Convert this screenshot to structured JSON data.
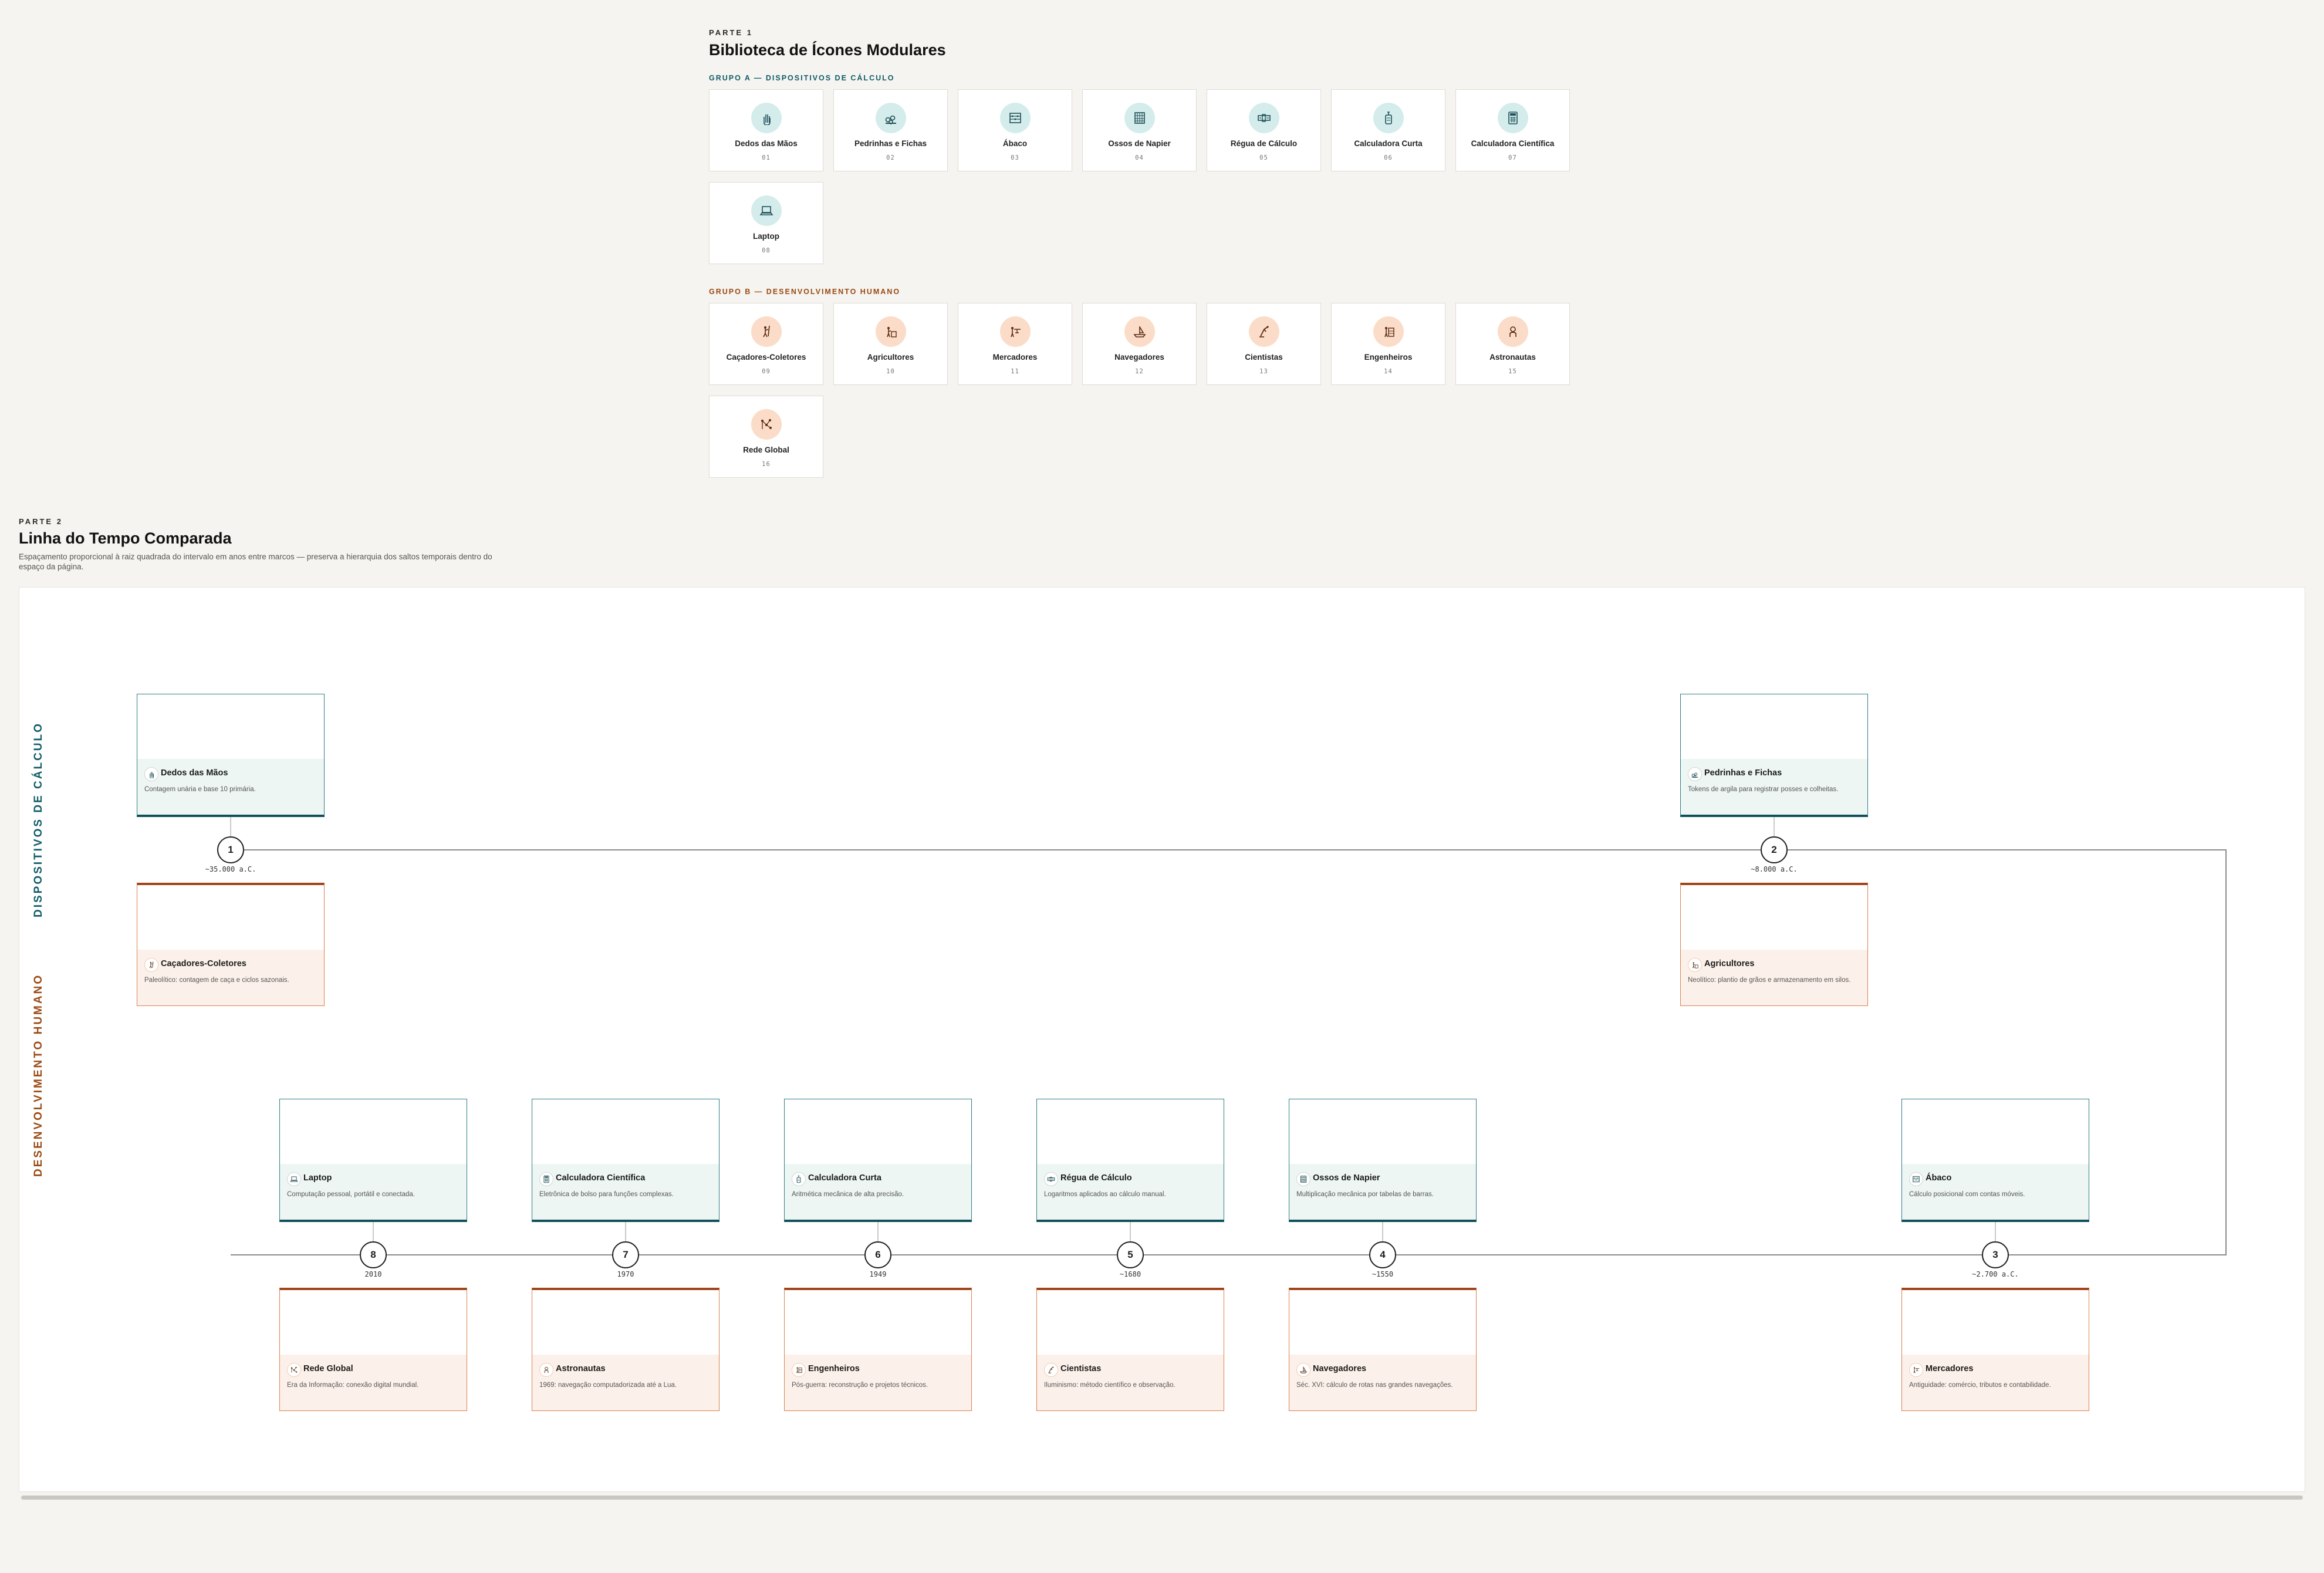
{
  "part1": {
    "eyebrow": "PARTE 1",
    "title": "Biblioteca de Ícones Modulares",
    "group_a_label": "GRUPO A — DISPOSITIVOS DE CÁLCULO",
    "group_b_label": "GRUPO B — DESENVOLVIMENTO HUMANO",
    "group_a": [
      {
        "name": "Dedos das Mãos",
        "num": "01",
        "icon": "hand-icon"
      },
      {
        "name": "Pedrinhas e Fichas",
        "num": "02",
        "icon": "pebbles-icon"
      },
      {
        "name": "Ábaco",
        "num": "03",
        "icon": "abacus-icon"
      },
      {
        "name": "Ossos de Napier",
        "num": "04",
        "icon": "napier-bones-icon"
      },
      {
        "name": "Régua de Cálculo",
        "num": "05",
        "icon": "slide-rule-icon"
      },
      {
        "name": "Calculadora Curta",
        "num": "06",
        "icon": "curta-calculator-icon"
      },
      {
        "name": "Calculadora Científica",
        "num": "07",
        "icon": "scientific-calculator-icon"
      },
      {
        "name": "Laptop",
        "num": "08",
        "icon": "laptop-icon"
      }
    ],
    "group_b": [
      {
        "name": "Caçadores-Coletores",
        "num": "09",
        "icon": "hunter-icon"
      },
      {
        "name": "Agricultores",
        "num": "10",
        "icon": "farmer-icon"
      },
      {
        "name": "Mercadores",
        "num": "11",
        "icon": "merchant-icon"
      },
      {
        "name": "Navegadores",
        "num": "12",
        "icon": "navigator-icon"
      },
      {
        "name": "Cientistas",
        "num": "13",
        "icon": "scientist-icon"
      },
      {
        "name": "Engenheiros",
        "num": "14",
        "icon": "engineer-icon"
      },
      {
        "name": "Astronautas",
        "num": "15",
        "icon": "astronaut-icon"
      },
      {
        "name": "Rede Global",
        "num": "16",
        "icon": "global-network-icon"
      }
    ]
  },
  "part2": {
    "eyebrow": "PARTE 2",
    "title": "Linha do Tempo Comparada",
    "subtitle_line1": "Espaçamento proporcional à raiz quadrada do intervalo em anos entre marcos — preserva a hierarquia dos saltos temporais dentro do",
    "subtitle_line2": "espaço da página.",
    "lane_devices": "DISPOSITIVOS DE CÁLCULO",
    "lane_human": "DESENVOLVIMENTO HUMANO",
    "milestones": [
      {
        "n": "1",
        "date": "~35.000 a.C.",
        "device": {
          "name": "Dedos das Mãos",
          "desc": "Contagem unária e base 10 primária."
        },
        "human": {
          "name": "Caçadores-Coletores",
          "desc": "Paleolítico: contagem de caça e ciclos sazonais."
        }
      },
      {
        "n": "2",
        "date": "~8.000 a.C.",
        "device": {
          "name": "Pedrinhas e Fichas",
          "desc": "Tokens de argila para registrar posses e colheitas."
        },
        "human": {
          "name": "Agricultores",
          "desc": "Neolítico: plantio de grãos e armazenamento em silos."
        }
      },
      {
        "n": "3",
        "date": "~2.700 a.C.",
        "device": {
          "name": "Ábaco",
          "desc": "Cálculo posicional com contas móveis."
        },
        "human": {
          "name": "Mercadores",
          "desc": "Antiguidade: comércio, tributos e contabilidade."
        }
      },
      {
        "n": "4",
        "date": "~1550",
        "device": {
          "name": "Ossos de Napier",
          "desc": "Multiplicação mecânica por tabelas de barras."
        },
        "human": {
          "name": "Navegadores",
          "desc": "Séc. XVI: cálculo de rotas nas grandes navegações."
        }
      },
      {
        "n": "5",
        "date": "~1680",
        "device": {
          "name": "Régua de Cálculo",
          "desc": "Logaritmos aplicados ao cálculo manual."
        },
        "human": {
          "name": "Cientistas",
          "desc": "Iluminismo: método científico e observação."
        }
      },
      {
        "n": "6",
        "date": "1949",
        "device": {
          "name": "Calculadora Curta",
          "desc": "Aritmética mecânica de alta precisão."
        },
        "human": {
          "name": "Engenheiros",
          "desc": "Pós-guerra: reconstrução e projetos técnicos."
        }
      },
      {
        "n": "7",
        "date": "1970",
        "device": {
          "name": "Calculadora Científica",
          "desc": "Eletrônica de bolso para funções complexas."
        },
        "human": {
          "name": "Astronautas",
          "desc": "1969: navegação computadorizada até a Lua."
        }
      },
      {
        "n": "8",
        "date": "2010",
        "device": {
          "name": "Laptop",
          "desc": "Computação pessoal, portátil e conectada."
        },
        "human": {
          "name": "Rede Global",
          "desc": "Era da Informação: conexão digital mundial."
        }
      }
    ]
  },
  "colors": {
    "teal": "#0f5c66",
    "orange": "#9a4a12",
    "dev_band": "#eef6f4",
    "hum_band": "#fcf1ea"
  }
}
